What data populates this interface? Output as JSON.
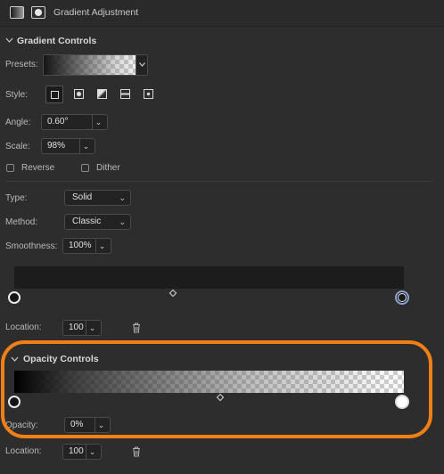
{
  "header": {
    "title": "Gradient Adjustment"
  },
  "gradient_controls": {
    "section_title": "Gradient Controls",
    "presets_label": "Presets:",
    "style_label": "Style:",
    "style_options": [
      "linear",
      "radial",
      "elliptical",
      "conical",
      "bitmap"
    ],
    "selected_style": "linear",
    "angle_label": "Angle:",
    "angle_value": "0.60°",
    "scale_label": "Scale:",
    "scale_value": "98%",
    "reverse_label": "Reverse",
    "reverse_checked": false,
    "dither_label": "Dither",
    "dither_checked": false,
    "type_label": "Type:",
    "type_value": "Solid",
    "method_label": "Method:",
    "method_value": "Classic",
    "smoothness_label": "Smoothness:",
    "smoothness_value": "100%",
    "location_label": "Location:",
    "location_value": "100"
  },
  "opacity_controls": {
    "section_title": "Opacity Controls",
    "opacity_label": "Opacity:",
    "opacity_value": "0%",
    "location_label": "Location:",
    "location_value": "100"
  },
  "colors": {
    "panel_bg": "#2d2d2d",
    "highlight_ring": "#f07f17",
    "selected_stop_ring": "#8a9fd6"
  }
}
